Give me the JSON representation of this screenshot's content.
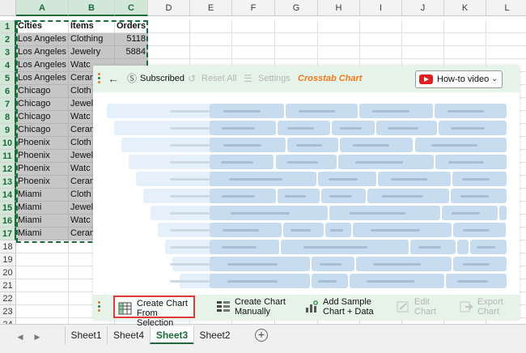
{
  "spreadsheet": {
    "columns": [
      "A",
      "B",
      "C",
      "D",
      "E",
      "F",
      "G",
      "H",
      "I",
      "J",
      "K",
      "L"
    ],
    "rows": [
      "1",
      "2",
      "3",
      "4",
      "5",
      "6",
      "7",
      "8",
      "9",
      "10",
      "11",
      "12",
      "13",
      "14",
      "15",
      "16",
      "17",
      "18",
      "19",
      "20",
      "21",
      "22",
      "23",
      "24"
    ],
    "header": [
      "Cities",
      "Items",
      "Orders"
    ],
    "data": [
      [
        "Los Angeles",
        "Clothing",
        "5118"
      ],
      [
        "Los Angeles",
        "Jewelry",
        "5884"
      ],
      [
        "Los Angeles",
        "Watc",
        ""
      ],
      [
        "Los Angeles",
        "Ceran",
        ""
      ],
      [
        "Chicago",
        "Cloth",
        ""
      ],
      [
        "Chicago",
        "Jewel",
        ""
      ],
      [
        "Chicago",
        "Watc",
        ""
      ],
      [
        "Chicago",
        "Ceran",
        ""
      ],
      [
        "Phoenix",
        "Cloth",
        ""
      ],
      [
        "Phoenix",
        "Jewel",
        ""
      ],
      [
        "Phoenix",
        "Watc",
        ""
      ],
      [
        "Phoenix",
        "Ceran",
        ""
      ],
      [
        "Miami",
        "Cloth",
        ""
      ],
      [
        "Miami",
        "Jewel",
        ""
      ],
      [
        "Miami",
        "Watc",
        ""
      ],
      [
        "Miami",
        "Ceran",
        ""
      ]
    ]
  },
  "sheet_tabs": [
    "Sheet1",
    "Sheet4",
    "Sheet3",
    "Sheet2"
  ],
  "active_sheet": "Sheet3",
  "panel": {
    "subscribed_label": "Subscribed",
    "reset_label": "Reset All",
    "settings_label": "Settings",
    "title": "Crosstab Chart",
    "howto_label": "How-to video",
    "actions": [
      {
        "line1": "Create Chart",
        "line2": "From Selection"
      },
      {
        "line1": "Create Chart",
        "line2": "Manually"
      },
      {
        "line1": "Add Sample",
        "line2": "Chart + Data"
      },
      {
        "line1": "Edit",
        "line2": "Chart"
      },
      {
        "line1": "Export",
        "line2": "Chart"
      }
    ]
  },
  "colors": {
    "accent_green": "#1d6b3a",
    "panel_bg": "#e5f3e9",
    "title_orange": "#f07a20",
    "highlight_red": "#e23a3a",
    "youtube_red": "#e02020"
  },
  "icons": {
    "back": "arrow-left-icon",
    "subscribed": "dollar-circle-icon",
    "reset": "reset-icon",
    "settings": "sliders-icon",
    "video": "youtube-icon"
  }
}
